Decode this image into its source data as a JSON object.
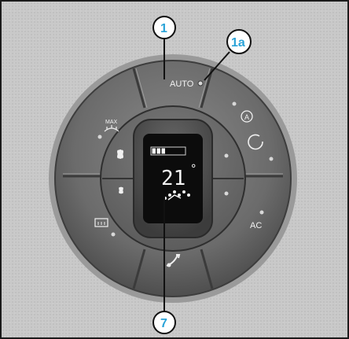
{
  "callouts": [
    {
      "label": "1"
    },
    {
      "label": "1a"
    },
    {
      "label": "7"
    }
  ],
  "buttons": {
    "auto": {
      "label": "AUTO",
      "icon": "auto-mode"
    },
    "recirc_auto": {
      "label": "A",
      "icon": "recirculation-auto-icon"
    },
    "recirc": {
      "icon": "recirculation-icon"
    },
    "ac": {
      "label": "AC"
    },
    "max_defrost": {
      "label": "MAX",
      "icon": "max-defrost-icon"
    },
    "fan_up": {
      "icon": "fan-speed-up-icon"
    },
    "fan_down": {
      "icon": "fan-speed-down-icon"
    },
    "rear_defrost": {
      "icon": "rear-window-defrost-icon"
    },
    "air_distribution": {
      "icon": "air-distribution-icon"
    },
    "temp_up": {
      "icon": "temperature-up-dot"
    },
    "temp_down": {
      "icon": "temperature-down-dot"
    }
  },
  "display": {
    "temperature": "21",
    "unit": "°",
    "fan_level_bars": 3,
    "fan_level_max": 7
  },
  "colors": {
    "callout": "#2aa3d8",
    "panel_outer": "#6f6f6f",
    "lcd": "#0c0c0c"
  }
}
